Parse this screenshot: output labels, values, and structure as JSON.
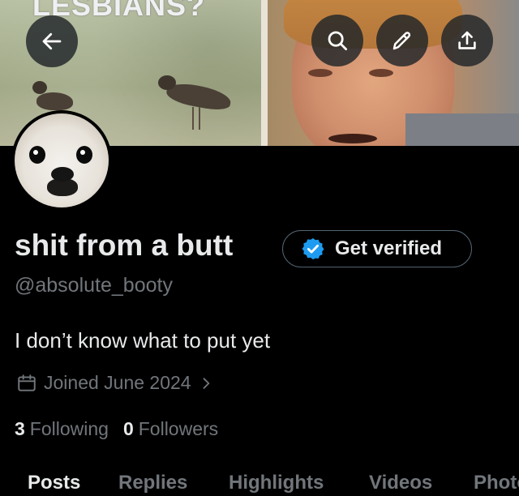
{
  "banner": {
    "caption": "LESBIANS?"
  },
  "header_actions": {
    "back_icon": "arrow-left-icon",
    "search_icon": "search-icon",
    "edit_icon": "pencil-icon",
    "share_icon": "share-icon"
  },
  "profile": {
    "display_name": "shit from a butt",
    "get_verified_label": "Get verified",
    "verified_icon": "verified-badge-icon",
    "handle": "@absolute_booty",
    "bio": "I don’t know what to put yet",
    "joined": "Joined June 2024",
    "following_count": "3",
    "following_label": "Following",
    "followers_count": "0",
    "followers_label": "Followers"
  },
  "tabs": [
    {
      "label": "Posts",
      "active": true
    },
    {
      "label": "Replies",
      "active": false
    },
    {
      "label": "Highlights",
      "active": false
    },
    {
      "label": "Videos",
      "active": false
    },
    {
      "label": "Photos",
      "active": false
    }
  ],
  "colors": {
    "background": "#000000",
    "primary_text": "#e7e9ea",
    "secondary_text": "#71767b",
    "verified_blue": "#1d9bf0",
    "border": "#536471"
  }
}
